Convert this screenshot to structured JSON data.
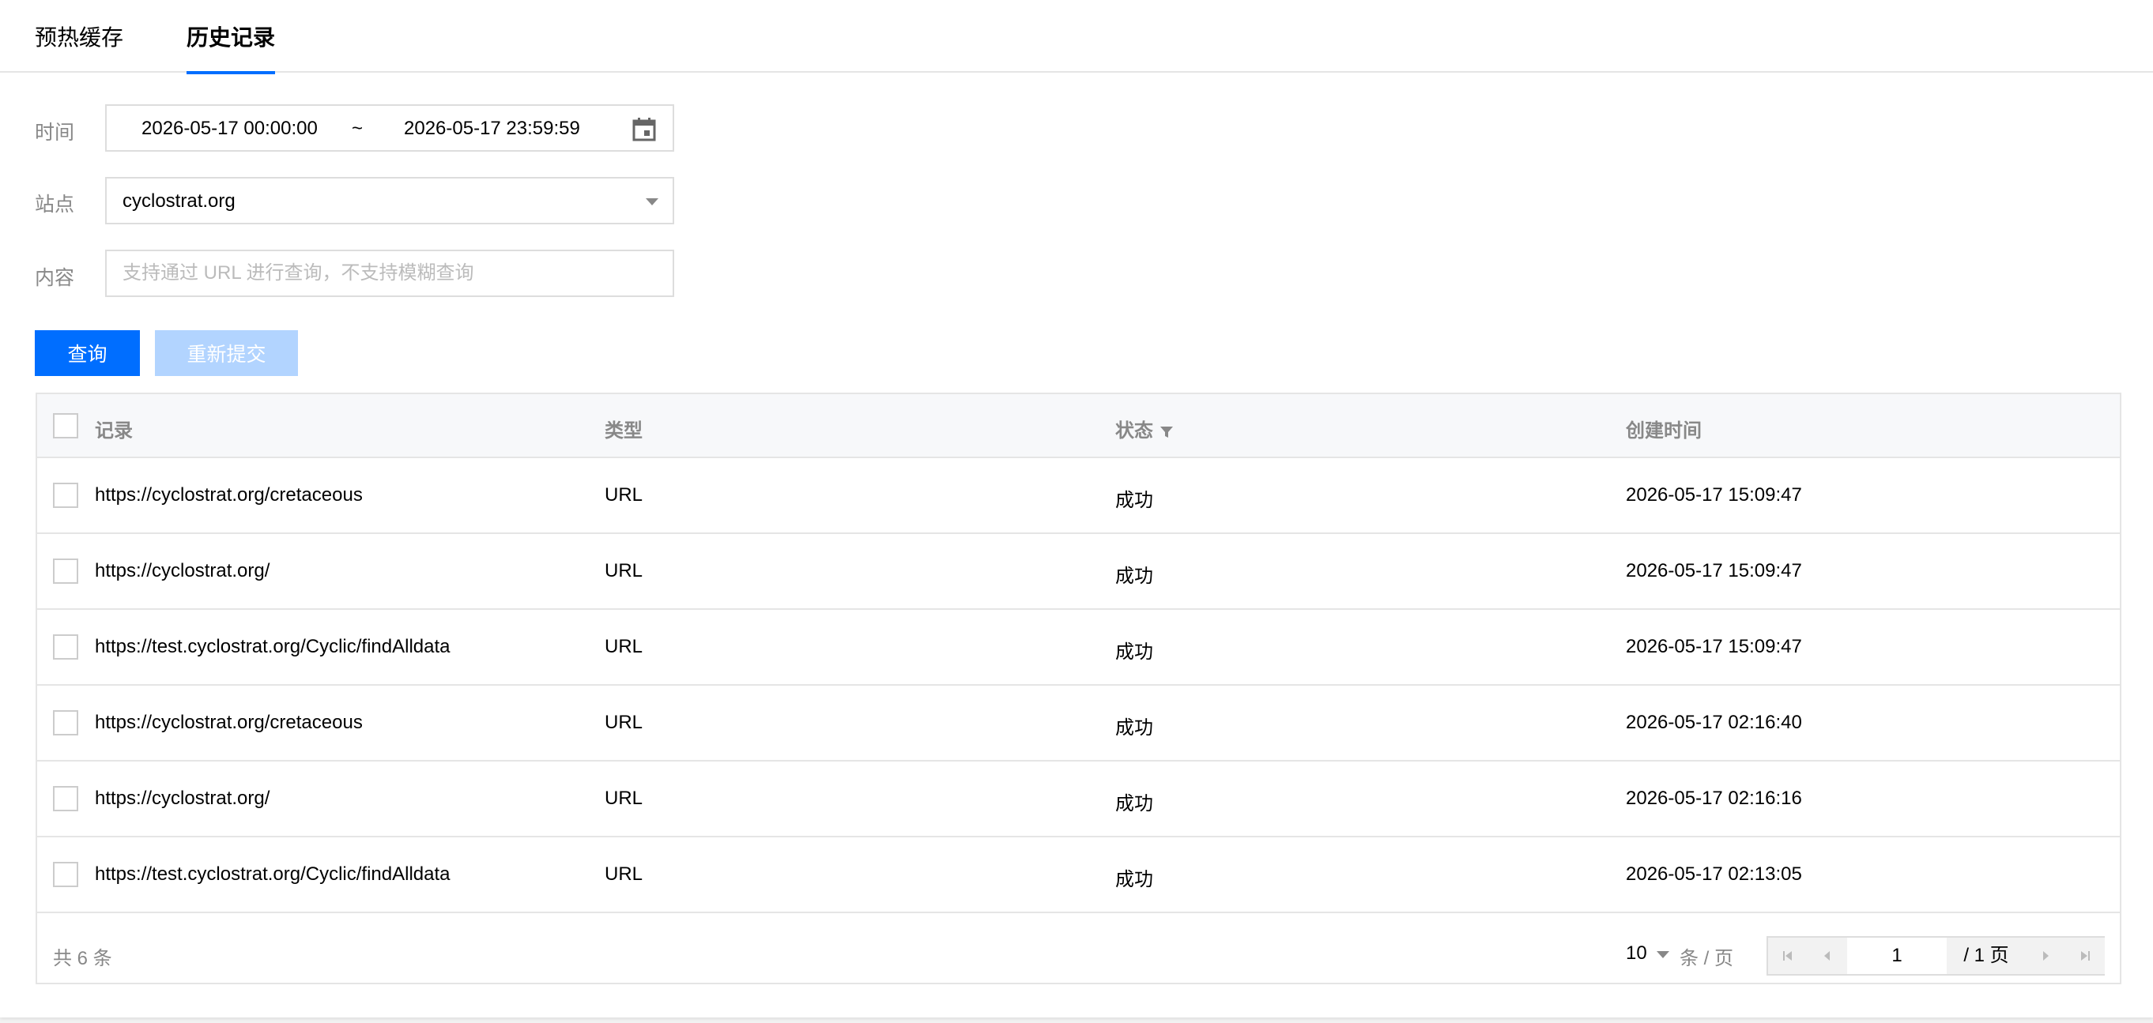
{
  "tabs": [
    {
      "label": "预热缓存"
    },
    {
      "label": "历史记录"
    }
  ],
  "form": {
    "time_label": "时间",
    "date_start": "2026-05-17 00:00:00",
    "date_separator": "~",
    "date_end": "2026-05-17 23:59:59",
    "site_label": "站点",
    "site_value": "cyclostrat.org",
    "content_label": "内容",
    "content_placeholder": "支持通过 URL 进行查询，不支持模糊查询",
    "content_value": ""
  },
  "buttons": {
    "query": "查询",
    "resubmit": "重新提交"
  },
  "table": {
    "headers": [
      "记录",
      "类型",
      "状态",
      "创建时间"
    ],
    "rows": [
      {
        "record": "https://cyclostrat.org/cretaceous",
        "type": "URL",
        "status": "成功",
        "created": "2026-05-17 15:09:47"
      },
      {
        "record": "https://cyclostrat.org/",
        "type": "URL",
        "status": "成功",
        "created": "2026-05-17 15:09:47"
      },
      {
        "record": "https://test.cyclostrat.org/Cyclic/findAlldata",
        "type": "URL",
        "status": "成功",
        "created": "2026-05-17 15:09:47"
      },
      {
        "record": "https://cyclostrat.org/cretaceous",
        "type": "URL",
        "status": "成功",
        "created": "2026-05-17 02:16:40"
      },
      {
        "record": "https://cyclostrat.org/",
        "type": "URL",
        "status": "成功",
        "created": "2026-05-17 02:16:16"
      },
      {
        "record": "https://test.cyclostrat.org/Cyclic/findAlldata",
        "type": "URL",
        "status": "成功",
        "created": "2026-05-17 02:13:05"
      }
    ]
  },
  "footer": {
    "total": "共 6 条",
    "page_size": "10",
    "per_page": "条 / 页",
    "current_page": "1",
    "total_pages": "/ 1 页"
  },
  "colors": {
    "accent": "#006eff",
    "disabled": "#b2d4ff"
  },
  "icons": [
    "calendar-icon",
    "caret-down-icon",
    "filter-icon",
    "first-page-icon",
    "prev-page-icon",
    "next-page-icon",
    "last-page-icon"
  ]
}
